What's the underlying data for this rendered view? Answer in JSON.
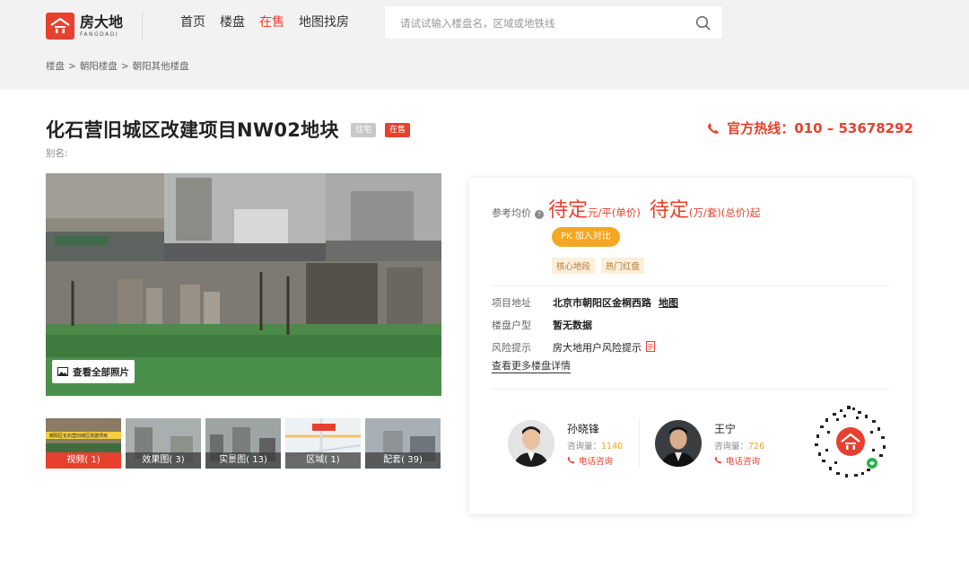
{
  "header": {
    "logo_cn": "房大地",
    "logo_en": "FANGDADI",
    "nav": [
      "首页",
      "楼盘",
      "在售",
      "地图找房"
    ],
    "nav_active_index": 2,
    "search_placeholder": "请试试输入楼盘名，区域或地铁线"
  },
  "breadcrumb": [
    "楼盘",
    ">",
    "朝阳楼盘",
    ">",
    "朝阳其他楼盘"
  ],
  "project": {
    "title": "化石营旧城区改建项目NW02地块",
    "tag_type": "住宅",
    "tag_status": "在售",
    "alias": "别名:",
    "hotline": "官方热线：010 – 53678292"
  },
  "gallery": {
    "view_all": "查看全部照片",
    "thumbs": [
      {
        "label": "视频( 1)",
        "banner": "朝阳区化石营旧城区改建项目"
      },
      {
        "label": "效果图( 3)"
      },
      {
        "label": "实景图( 13)"
      },
      {
        "label": "区域( 1)"
      },
      {
        "label": "配套( 39)"
      }
    ]
  },
  "price": {
    "label": "参考均价",
    "value1": "待定",
    "unit1": "元/平(单价)",
    "value2": "待定",
    "unit2": "(万/套)(总价)起",
    "pk_button": "PK 加入对比",
    "highlights": [
      "核心地段",
      "热门红盘"
    ]
  },
  "details": {
    "address_label": "项目地址",
    "address": "北京市朝阳区金桐西路",
    "map_link": "地图",
    "type_label": "楼盘户型",
    "type_value": "暂无数据",
    "risk_label": "风险提示",
    "risk_value": "房大地用户风险提示",
    "more_link": "查看更多楼盘详情"
  },
  "agents": [
    {
      "name": "孙晓锋",
      "query_label": "咨询量：",
      "query_count": "1140",
      "call": "电话咨询"
    },
    {
      "name": "王宁",
      "query_label": "咨询量：",
      "query_count": "726",
      "call": "电话咨询"
    }
  ],
  "colors": {
    "accent": "#e8402e",
    "orange": "#f5a623"
  }
}
